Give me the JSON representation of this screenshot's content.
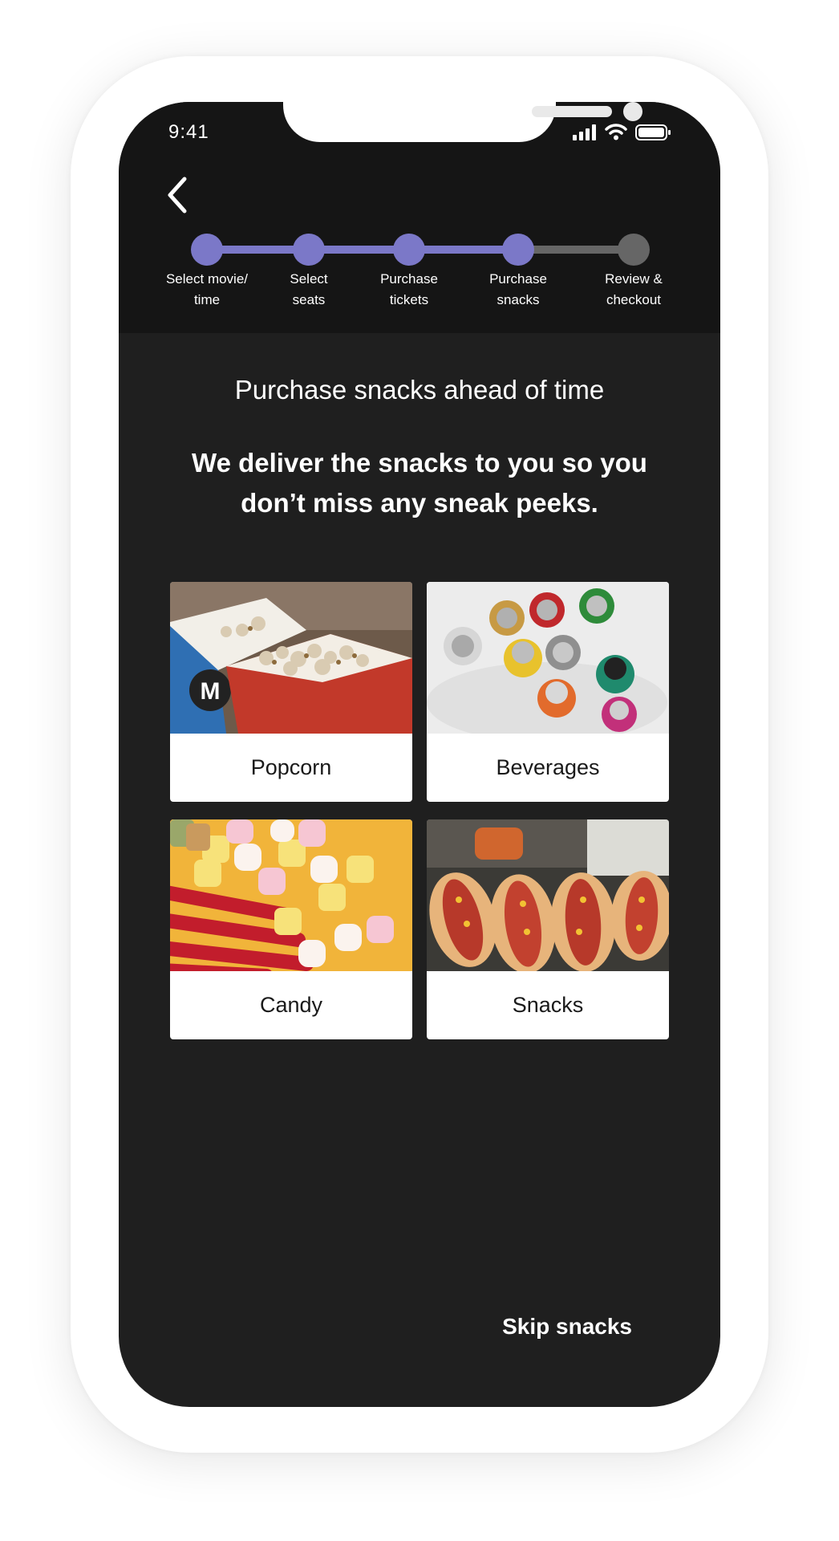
{
  "status_bar": {
    "time": "9:41"
  },
  "colors": {
    "accent": "#7b78c8",
    "inactive": "#666666",
    "background": "#1f1f1f",
    "header_background": "#151515"
  },
  "progress": {
    "current_step": 4,
    "steps": [
      {
        "label": "Select movie/\ntime",
        "state": "complete"
      },
      {
        "label": "Select\nseats",
        "state": "complete"
      },
      {
        "label": "Purchase\ntickets",
        "state": "complete"
      },
      {
        "label": "Purchase\nsnacks",
        "state": "current"
      },
      {
        "label": "Review &\ncheckout",
        "state": "upcoming"
      }
    ]
  },
  "main": {
    "headline": "Purchase snacks ahead of time",
    "subhead": "We deliver the snacks to you so you don’t miss any sneak peeks.",
    "categories": [
      {
        "label": "Popcorn",
        "image": "popcorn-photo"
      },
      {
        "label": "Beverages",
        "image": "beverage-cans-photo"
      },
      {
        "label": "Candy",
        "image": "candy-photo"
      },
      {
        "label": "Snacks",
        "image": "hot-dogs-photo"
      }
    ],
    "skip_label": "Skip snacks"
  },
  "icons": [
    "back-chevron-icon",
    "signal-icon",
    "wifi-icon",
    "battery-icon"
  ]
}
